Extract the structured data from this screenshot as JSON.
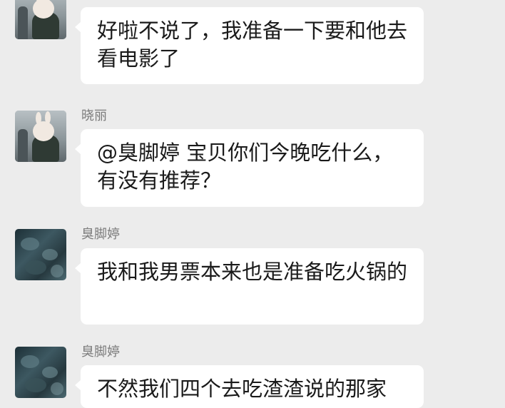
{
  "messages": [
    {
      "sender": "",
      "text": "好啦不说了，我准备一下要和他去看电影了"
    },
    {
      "sender": "晓丽",
      "text": "@臭脚婷 宝贝你们今晚吃什么，有没有推荐？"
    },
    {
      "sender": "臭脚婷",
      "text": "我和我男票本来也是准备吃火锅的"
    },
    {
      "sender": "臭脚婷",
      "text": "不然我们四个去吃渣渣说的那家"
    }
  ],
  "colors": {
    "background": "#ececec",
    "bubble": "#ffffff",
    "name": "#7b7b7b",
    "text": "#1a1a1a"
  },
  "icons": [
    "rabbit-avatar-icon",
    "ocean-avatar-icon"
  ]
}
